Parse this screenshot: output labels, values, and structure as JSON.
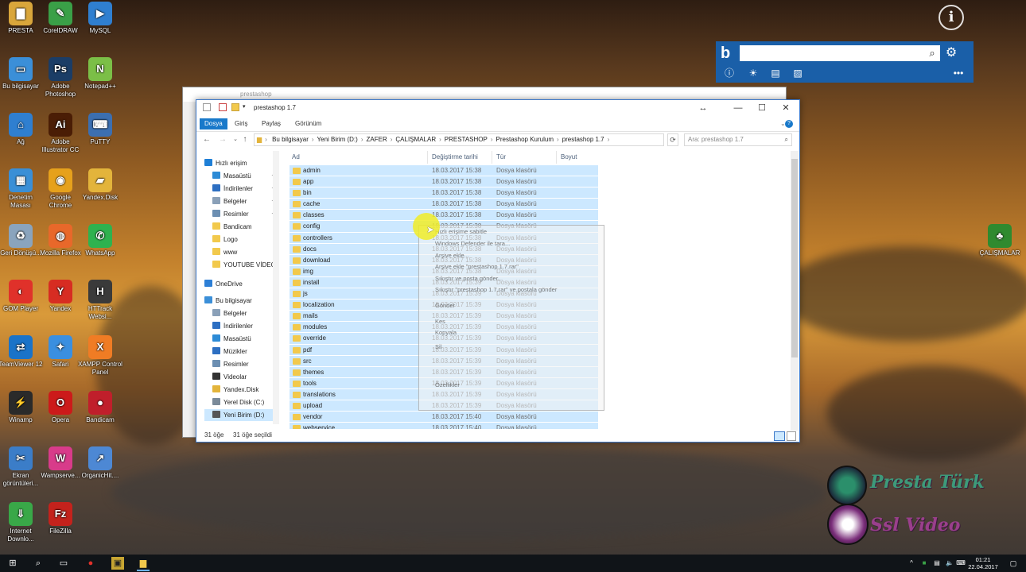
{
  "desktop": {
    "icons": [
      {
        "label": "PRESTA",
        "color": "#d9a63b",
        "glyph": "▇"
      },
      {
        "label": "CorelDRAW",
        "color": "#3aa047",
        "glyph": "✎"
      },
      {
        "label": "MySQL",
        "color": "#2f7fd0",
        "glyph": "▶"
      },
      {
        "label": "Bu bilgisayar",
        "color": "#3b8fd8",
        "glyph": "▭"
      },
      {
        "label": "Adobe Photoshop",
        "color": "#1b3d66",
        "glyph": "Ps"
      },
      {
        "label": "Notepad++",
        "color": "#7bbf47",
        "glyph": "N"
      },
      {
        "label": "Ağ",
        "color": "#2f7fd0",
        "glyph": "⌂"
      },
      {
        "label": "Adobe Illustrator CC",
        "color": "#4a1d05",
        "glyph": "Ai"
      },
      {
        "label": "PuTTY",
        "color": "#3c6fb0",
        "glyph": "⌨"
      },
      {
        "label": "Denetim Masası",
        "color": "#3a8fd6",
        "glyph": "▦"
      },
      {
        "label": "Google Chrome",
        "color": "#e6a11c",
        "glyph": "◉"
      },
      {
        "label": "Yandex.Disk",
        "color": "#e3b43b",
        "glyph": "▰"
      },
      {
        "label": "Geri Dönüşü...",
        "color": "#8aa4bd",
        "glyph": "♻"
      },
      {
        "label": "Mozilla Firefox",
        "color": "#e8682a",
        "glyph": "◍"
      },
      {
        "label": "WhatsApp",
        "color": "#2fb24f",
        "glyph": "✆"
      },
      {
        "label": "GOM Player",
        "color": "#e0312a",
        "glyph": "◐"
      },
      {
        "label": "Yandex",
        "color": "#d72c22",
        "glyph": "Y"
      },
      {
        "label": "HTTrack Websi...",
        "color": "#3a3a3a",
        "glyph": "H"
      },
      {
        "label": "TeamViewer 12",
        "color": "#1a73c8",
        "glyph": "⇄"
      },
      {
        "label": "Safari",
        "color": "#3a8fe0",
        "glyph": "✦"
      },
      {
        "label": "XAMPP Control Panel",
        "color": "#f07c24",
        "glyph": "X"
      },
      {
        "label": "Winamp",
        "color": "#2a2a2a",
        "glyph": "⚡"
      },
      {
        "label": "Opera",
        "color": "#cc1a1a",
        "glyph": "O"
      },
      {
        "label": "Bandicam",
        "color": "#c01f2b",
        "glyph": "●"
      },
      {
        "label": "Ekran görüntüleri...",
        "color": "#3b7dc8",
        "glyph": "✂"
      },
      {
        "label": "Wampserve...",
        "color": "#d83b8a",
        "glyph": "W"
      },
      {
        "label": "OrganicHit....",
        "color": "#4d88d4",
        "glyph": "↗"
      },
      {
        "label": "Internet Downlo...",
        "color": "#39a848",
        "glyph": "⇓"
      },
      {
        "label": "FileZilla",
        "color": "#c4221c",
        "glyph": "Fz"
      }
    ],
    "right_icon": {
      "label": "ÇALIŞMALAR"
    }
  },
  "bing": {
    "search_placeholder": "",
    "search_icon": "search-icon",
    "settings_icon": "gear-icon",
    "logo": "b",
    "more": "•••"
  },
  "back_window": {
    "title": "prestashop"
  },
  "window": {
    "title": "prestashop 1.7",
    "controls": {
      "minimize": "—",
      "maximize": "☐",
      "close": "✕"
    },
    "ribbon_tabs": [
      "Dosya",
      "Giriş",
      "Paylaş",
      "Görünüm"
    ],
    "breadcrumb": [
      "Bu bilgisayar",
      "Yeni Birim (D:)",
      "ZAFER",
      "ÇALIŞMALAR",
      "PRESTASHOP",
      "Prestashop Kurulum",
      "prestashop 1.7"
    ],
    "search_placeholder": "Ara: prestashop 1.7",
    "columns": {
      "name": "Ad",
      "date": "Değiştirme tarihi",
      "type": "Tür",
      "size": "Boyut"
    },
    "nav": [
      {
        "label": "Hızlı erişim",
        "indent": 0,
        "icon": "star-icon",
        "color": "#1f7fd6"
      },
      {
        "label": "Masaüstü",
        "indent": 1,
        "icon": "desktop-icon",
        "color": "#2d8bd6",
        "pin": true
      },
      {
        "label": "İndirilenler",
        "indent": 1,
        "icon": "download-icon",
        "color": "#2d6fc2",
        "pin": true
      },
      {
        "label": "Belgeler",
        "indent": 1,
        "icon": "documents-icon",
        "color": "#8aa0b8",
        "pin": true
      },
      {
        "label": "Resimler",
        "indent": 1,
        "icon": "pictures-icon",
        "color": "#6c8fb2",
        "pin": true
      },
      {
        "label": "Bandicam",
        "indent": 1,
        "icon": "folder-icon",
        "color": "#f2c94c"
      },
      {
        "label": "Logo",
        "indent": 1,
        "icon": "folder-icon",
        "color": "#f2c94c"
      },
      {
        "label": "www",
        "indent": 1,
        "icon": "folder-icon",
        "color": "#f2c94c"
      },
      {
        "label": "YOUTUBE VİDEO",
        "indent": 1,
        "icon": "folder-icon",
        "color": "#f2c94c"
      },
      {
        "label": "OneDrive",
        "indent": 0,
        "icon": "cloud-icon",
        "color": "#2d7fd6"
      },
      {
        "label": "Bu bilgisayar",
        "indent": 0,
        "icon": "computer-icon",
        "color": "#3b8fd8"
      },
      {
        "label": "Belgeler",
        "indent": 1,
        "icon": "documents-icon",
        "color": "#8aa0b8"
      },
      {
        "label": "İndirilenler",
        "indent": 1,
        "icon": "download-icon",
        "color": "#2d6fc2"
      },
      {
        "label": "Masaüstü",
        "indent": 1,
        "icon": "desktop-icon",
        "color": "#2d8bd6"
      },
      {
        "label": "Müzikler",
        "indent": 1,
        "icon": "music-icon",
        "color": "#2d6fc2"
      },
      {
        "label": "Resimler",
        "indent": 1,
        "icon": "pictures-icon",
        "color": "#6c8fb2"
      },
      {
        "label": "Videolar",
        "indent": 1,
        "icon": "video-icon",
        "color": "#333"
      },
      {
        "label": "Yandex.Disk",
        "indent": 1,
        "icon": "yandex-disk-icon",
        "color": "#e3b43b"
      },
      {
        "label": "Yerel Disk (C:)",
        "indent": 1,
        "icon": "drive-icon",
        "color": "#7a8a99"
      },
      {
        "label": "Yeni Birim (D:)",
        "indent": 1,
        "icon": "drive-icon",
        "color": "#555",
        "selected": true
      }
    ],
    "files": [
      {
        "name": "admin",
        "date": "18.03.2017 15:38",
        "type": "Dosya klasörü"
      },
      {
        "name": "app",
        "date": "18.03.2017 15:38",
        "type": "Dosya klasörü"
      },
      {
        "name": "bin",
        "date": "18.03.2017 15:38",
        "type": "Dosya klasörü"
      },
      {
        "name": "cache",
        "date": "18.03.2017 15:38",
        "type": "Dosya klasörü"
      },
      {
        "name": "classes",
        "date": "18.03.2017 15:38",
        "type": "Dosya klasörü"
      },
      {
        "name": "config",
        "date": "18.03.2017 15:38",
        "type": "Dosya klasörü"
      },
      {
        "name": "controllers",
        "date": "18.03.2017 15:38",
        "type": "Dosya klasörü"
      },
      {
        "name": "docs",
        "date": "18.03.2017 15:38",
        "type": "Dosya klasörü"
      },
      {
        "name": "download",
        "date": "18.03.2017 15:38",
        "type": "Dosya klasörü"
      },
      {
        "name": "img",
        "date": "18.03.2017 15:38",
        "type": "Dosya klasörü"
      },
      {
        "name": "install",
        "date": "18.03.2017 15:39",
        "type": "Dosya klasörü"
      },
      {
        "name": "js",
        "date": "18.03.2017 15:39",
        "type": "Dosya klasörü"
      },
      {
        "name": "localization",
        "date": "18.03.2017 15:39",
        "type": "Dosya klasörü"
      },
      {
        "name": "mails",
        "date": "18.03.2017 15:39",
        "type": "Dosya klasörü"
      },
      {
        "name": "modules",
        "date": "18.03.2017 15:39",
        "type": "Dosya klasörü"
      },
      {
        "name": "override",
        "date": "18.03.2017 15:39",
        "type": "Dosya klasörü"
      },
      {
        "name": "pdf",
        "date": "18.03.2017 15:39",
        "type": "Dosya klasörü"
      },
      {
        "name": "src",
        "date": "18.03.2017 15:39",
        "type": "Dosya klasörü"
      },
      {
        "name": "themes",
        "date": "18.03.2017 15:39",
        "type": "Dosya klasörü"
      },
      {
        "name": "tools",
        "date": "18.03.2017 15:39",
        "type": "Dosya klasörü"
      },
      {
        "name": "translations",
        "date": "18.03.2017 15:39",
        "type": "Dosya klasörü"
      },
      {
        "name": "upload",
        "date": "18.03.2017 15:39",
        "type": "Dosya klasörü"
      },
      {
        "name": "vendor",
        "date": "18.03.2017 15:40",
        "type": "Dosya klasörü"
      },
      {
        "name": "webservice",
        "date": "18.03.2017 15:40",
        "type": "Dosya klasörü"
      }
    ],
    "status": {
      "count": "31 öğe",
      "selected": "31 öğe seçildi"
    },
    "context_menu": [
      "Hızlı erişime sabitle",
      "Windows Defender ile tara...",
      "Arşive ekle...",
      "Arşive ekle \"prestashop 1.7.rar\"",
      "Sıkıştır ve posta gönder...",
      "Sıkıştır \"prestashop 1.7.rar\" ve postala gönder",
      "Gönder",
      "Kes",
      "Kopyala",
      "Sil",
      "Özellikler"
    ]
  },
  "branding": {
    "line1": "Presta Türk",
    "line2": "Ssl Video"
  },
  "taskbar": {
    "time": "01:21",
    "date": "22.04.2017"
  }
}
